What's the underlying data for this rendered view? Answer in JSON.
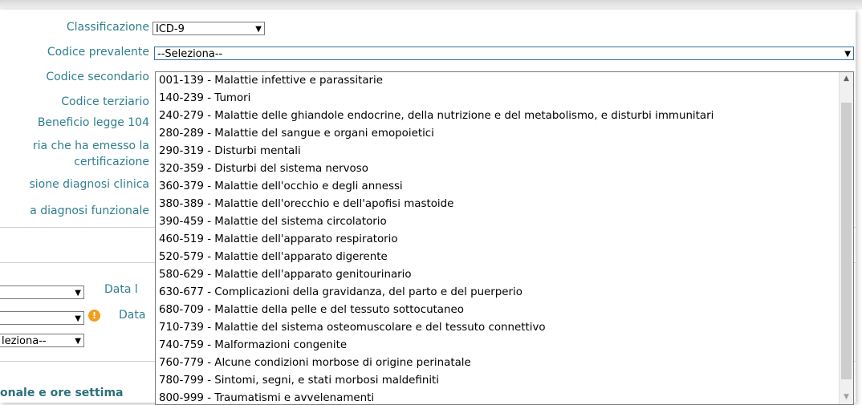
{
  "form": {
    "labels": {
      "classificazione": "Classificazione",
      "codice_prevalente": "Codice prevalente",
      "codice_secondario": "Codice secondario",
      "codice_terziario": "Codice terziario",
      "beneficio_104": "Beneficio legge 104",
      "struttura_line1": "ria che ha emesso la",
      "struttura_line2": "certificazione",
      "revisione_diagnosi": "sione diagnosi clinica",
      "diagnosi_funzionale": "a diagnosi funzionale"
    },
    "classificazione_value": "ICD-9",
    "codice_prevalente_value": "--Seleziona--"
  },
  "lower": {
    "data_label_1": "Data l",
    "data_label_2": "Data",
    "select_value": "leziona--",
    "footer_text": "onale e ore settima"
  },
  "dropdown": {
    "options": [
      "001-139 - Malattie infettive e parassitarie",
      "140-239 - Tumori",
      "240-279 - Malattie delle ghiandole endocrine, della nutrizione e del metabolismo, e disturbi immunitari",
      "280-289 - Malattie del sangue e organi emopoietici",
      "290-319 - Disturbi mentali",
      "320-359 - Disturbi del sistema nervoso",
      "360-379 - Malattie dell'occhio e degli annessi",
      "380-389 - Malattie dell'orecchio e dell'apofisi mastoide",
      "390-459 - Malattie del sistema circolatorio",
      "460-519 - Malattie dell'apparato respiratorio",
      "520-579 - Malattie dell'apparato digerente",
      "580-629 - Malattie dell'apparato genitourinario",
      "630-677 - Complicazioni della gravidanza, del parto e del puerperio",
      "680-709 - Malattie della pelle e del tessuto sottocutaneo",
      "710-739 - Malattie del sistema osteomuscolare e del tessuto connettivo",
      "740-759 - Malformazioni congenite",
      "760-779 - Alcune condizioni morbose di origine perinatale",
      "780-799 - Sintomi, segni, e stati morbosi maldefiniti",
      "800-999 - Traumatismi e avvelenamenti"
    ]
  },
  "icons": {
    "dropdown_arrow": "▼",
    "scroll_up": "▲",
    "scroll_down": "▼",
    "warning": "!"
  },
  "colors": {
    "label_color": "#2f7f8f",
    "warning_color": "#f0a020"
  }
}
